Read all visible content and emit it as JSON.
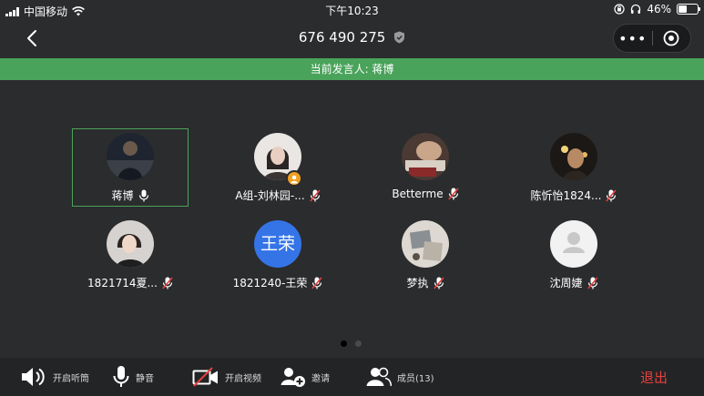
{
  "status_bar": {
    "carrier": "中国移动",
    "time": "下午10:23",
    "battery": "46%"
  },
  "nav": {
    "meeting_id": "676 490 275",
    "more_label": "•••"
  },
  "banner": {
    "text": "当前发言人: 蒋博"
  },
  "participants": [
    {
      "name": "蒋博",
      "mic": "on",
      "active": true
    },
    {
      "name": "A组-刘林园-...",
      "mic": "muted",
      "host": true
    },
    {
      "name": "Betterme",
      "mic": "muted"
    },
    {
      "name": "陈忻怡1824...",
      "mic": "muted"
    },
    {
      "name": "1821714夏...",
      "mic": "muted"
    },
    {
      "name": "1821240-王荣",
      "mic": "muted",
      "avatar_text": "王荣"
    },
    {
      "name": "梦执",
      "mic": "muted"
    },
    {
      "name": "沈周婕",
      "mic": "muted"
    }
  ],
  "pager": {
    "pages": 2,
    "current": 1
  },
  "toolbar": {
    "speaker_label": "开启听筒",
    "mute_label": "静音",
    "video_label": "开启视频",
    "invite_label": "邀请",
    "members_label": "成员(13)",
    "exit_label": "退出"
  },
  "colors": {
    "background": "#2b2c2e",
    "accent_green": "#4aa35a",
    "exit_red": "#e6403f",
    "avatar_blue": "#3574e7",
    "mute_red": "#e6403f"
  }
}
